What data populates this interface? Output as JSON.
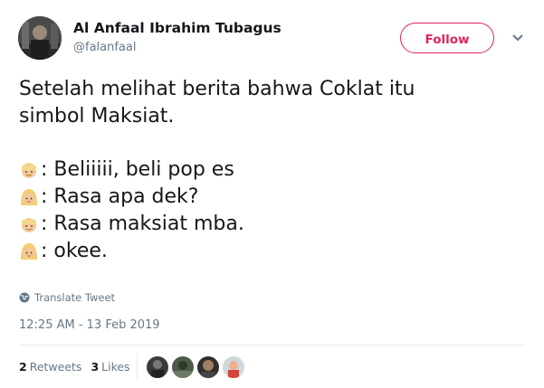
{
  "author": {
    "name": "Al Anfaal Ibrahim Tubagus",
    "handle": "@falanfaal",
    "avatar_icon": "profile-photo"
  },
  "actions": {
    "follow_label": "Follow",
    "menu_icon": "chevron-down-icon",
    "accent_color": "#e0245e"
  },
  "tweet": {
    "intro_line_1": "Setelah melihat berita bahwa Coklat itu",
    "intro_line_2": "simbol Maksiat.",
    "dialogue": [
      {
        "speaker_icon": "person-blond-emoji",
        "text": ": Beliiiii, beli pop es"
      },
      {
        "speaker_icon": "woman-blond-emoji",
        "text": ": Rasa apa dek?"
      },
      {
        "speaker_icon": "person-blond-emoji",
        "text": ": Rasa maksiat mba."
      },
      {
        "speaker_icon": "woman-blond-emoji",
        "text": ": okee."
      }
    ]
  },
  "translate_label": "Translate Tweet",
  "timestamp": "12:25 AM - 13 Feb 2019",
  "stats": {
    "retweets_count": "2",
    "retweets_label": "Retweets",
    "likes_count": "3",
    "likes_label": "Likes"
  },
  "likers": [
    "liker-avatar-1",
    "liker-avatar-2",
    "liker-avatar-3",
    "liker-avatar-4"
  ]
}
